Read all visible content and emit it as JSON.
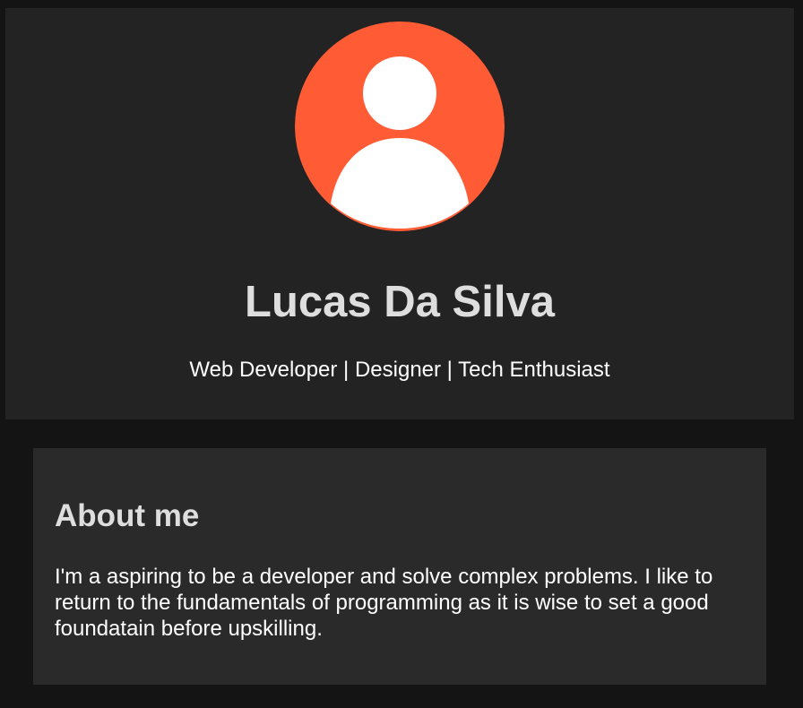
{
  "profile": {
    "avatar_icon": "user-silhouette-icon",
    "avatar_color": "#ff5c35",
    "name": "Lucas Da Silva",
    "tagline": "Web Developer | Designer | Tech Enthusiast"
  },
  "about": {
    "title": "About me",
    "text": "I'm a aspiring to be a developer and solve complex problems. I like to return to the fundamentals of programming as it is wise to set a good foundatain before upskilling."
  }
}
